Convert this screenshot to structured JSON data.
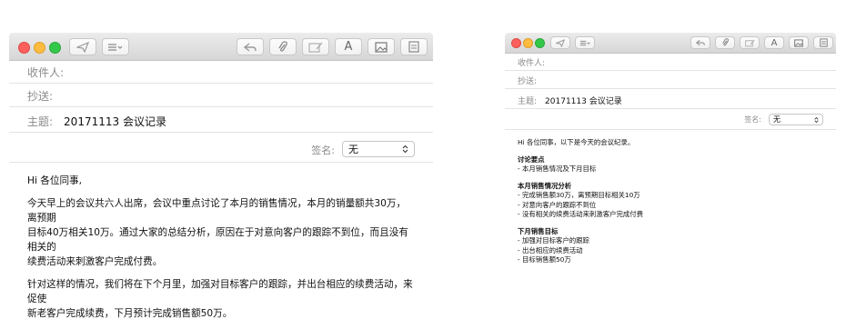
{
  "left_window": {
    "toolbar": {
      "send_icon": "paper-plane-icon",
      "header_fields_icon": "list-menu-icon",
      "reply_icon": "reply-arrow-icon",
      "attach_icon": "paperclip-icon",
      "markup_icon": "markup-icon",
      "format_label": "A",
      "photo_icon": "photo-browser-icon",
      "stationery_icon": "stationery-icon"
    },
    "to_label": "收件人:",
    "cc_label": "抄送:",
    "subject_label": "主题:",
    "subject_value": "20171113 会议记录",
    "signature_label": "签名:",
    "signature_value": "无",
    "body": {
      "greeting": "Hi 各位同事,",
      "para1_line1": "今天早上的会议共六人出席，会议中重点讨论了本月的销售情况，本月的销量额共30万，离预期",
      "para1_line2": "目标40万相关10万。通过大家的总结分析，原因在于对意向客户的跟踪不到位，而且没有相关的",
      "para1_line3": "续费活动来刺激客户完成付费。",
      "para2_line1": "针对这样的情况，我们将在下个月里，加强对目标客户的跟踪，并出台相应的续费活动，来促使",
      "para2_line2": "新老客户完成续费，下月预计完成销售额50万。"
    }
  },
  "right_window": {
    "toolbar": {
      "format_label": "A"
    },
    "to_label": "收件人:",
    "cc_label": "抄送:",
    "subject_label": "主题:",
    "subject_value": "20171113 会议记录",
    "signature_label": "签名:",
    "signature_value": "无",
    "body": {
      "greeting": "Hi 各位同事，以下是今天的会议纪录。",
      "section1_title": "讨论要点",
      "section1_items": [
        "- 本月销售情况及下月目标"
      ],
      "section2_title": "本月销售情况分析",
      "section2_items": [
        "- 完成销售额30万，离预期目标相关10万",
        "- 对意向客户的跟踪不到位",
        "- 没有相关的续费活动来刺激客户完成付费"
      ],
      "section3_title": "下月销售目标",
      "section3_items": [
        "- 加强对目标客户的跟踪",
        "- 出台相应的续费活动",
        "- 目标销售额50万"
      ]
    }
  },
  "colors": {
    "close": "#fc605c",
    "minimize": "#fdbc40",
    "zoom": "#34c84a"
  }
}
